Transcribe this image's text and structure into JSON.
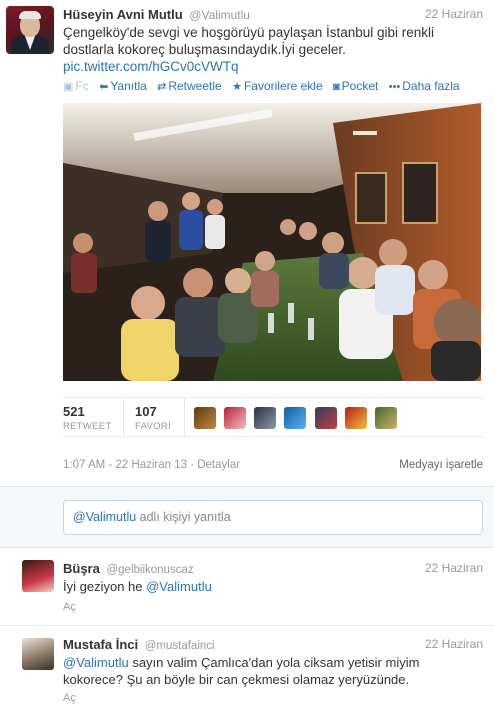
{
  "tweet": {
    "name": "Hüseyin Avni Mutlu",
    "handle": "@Valimutlu",
    "date": "22 Haziran",
    "text_line1": "Çengelköy'de sevgi ve hoşgörüyü paylaşan İstanbul gibi renkli",
    "text_line2": "dostlarla kokoreç buluşmasındaydık.İyi geceler.",
    "link": "pic.twitter.com/hGCv0cVWTq",
    "actions": {
      "fb": "Fc",
      "reply": "Yanıtla",
      "retweet": "Retweetle",
      "favorite": "Favorilere ekle",
      "pocket": "Pocket",
      "more": "Daha fazla"
    },
    "stats": {
      "retweets": "521",
      "retweets_label": "RETWEET",
      "favorites": "107",
      "favorites_label": "FAVORİ"
    },
    "meta": "1:07 AM - 22 Haziran 13 · Detaylar",
    "flag_media": "Medyayı işaretle"
  },
  "reply_box": {
    "to": "@Valimutlu",
    "placeholder": "adlı kişiyi yanıtla"
  },
  "replies": [
    {
      "name": "Büşra",
      "handle": "@gelbiikonuscaz",
      "date": "22 Haziran",
      "text_pre": "İyi geziyon he ",
      "mention": "@Valimutlu",
      "text_post": "",
      "action": "Aç"
    },
    {
      "name": "Mustafa İnci",
      "handle": "@mustafainci",
      "date": "22 Haziran",
      "mention": "@Valimutlu",
      "text_post": " sayın valim Çamlıca'dan yola ciksam yetisir miyim",
      "text_line2": "kokorece? Şu an böyle bir can çekmesi olamaz yeryüzünde.",
      "action": "Aç"
    }
  ]
}
